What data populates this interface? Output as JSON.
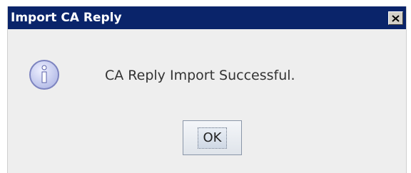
{
  "dialog": {
    "title": "Import CA Reply",
    "message": "CA Reply Import Successful.",
    "ok_label": "OK",
    "icon": "info-icon",
    "close_icon": "close-icon"
  },
  "colors": {
    "titlebar": "#0a246a",
    "title_text": "#ffffff",
    "body_background": "#eeeeee",
    "icon_fill": "#c9cef0"
  }
}
